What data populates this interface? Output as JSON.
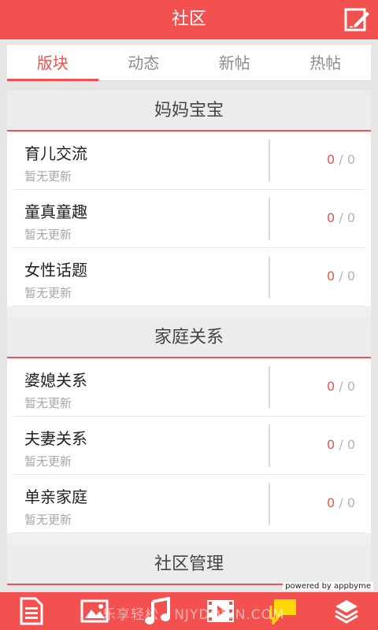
{
  "header": {
    "title": "社区"
  },
  "tabs": [
    {
      "label": "版块"
    },
    {
      "label": "动态"
    },
    {
      "label": "新帖"
    },
    {
      "label": "热帖"
    }
  ],
  "sections": [
    {
      "title": "妈妈宝宝",
      "forums": [
        {
          "name": "育儿交流",
          "status": "暂无更新",
          "today": "0",
          "sep": "/",
          "total": "0"
        },
        {
          "name": "童真童趣",
          "status": "暂无更新",
          "today": "0",
          "sep": "/",
          "total": "0"
        },
        {
          "name": "女性话题",
          "status": "暂无更新",
          "today": "0",
          "sep": "/",
          "total": "0"
        }
      ]
    },
    {
      "title": "家庭关系",
      "forums": [
        {
          "name": "婆媳关系",
          "status": "暂无更新",
          "today": "0",
          "sep": "/",
          "total": "0"
        },
        {
          "name": "夫妻关系",
          "status": "暂无更新",
          "today": "0",
          "sep": "/",
          "total": "0"
        },
        {
          "name": "单亲家庭",
          "status": "暂无更新",
          "today": "0",
          "sep": "/",
          "total": "0"
        }
      ]
    },
    {
      "title": "社区管理",
      "forums": []
    }
  ],
  "footer": {
    "powered": "powered by appbyme",
    "watermark": "乐享轻松 · NJYDOWN.COM"
  },
  "icons": {
    "edit": "edit-icon",
    "bottom": [
      "article-icon",
      "image-icon",
      "music-icon",
      "video-icon",
      "community-icon",
      "settings-icon"
    ]
  },
  "colors": {
    "accent": "#f2514f",
    "active_icon": "#ffd800"
  }
}
